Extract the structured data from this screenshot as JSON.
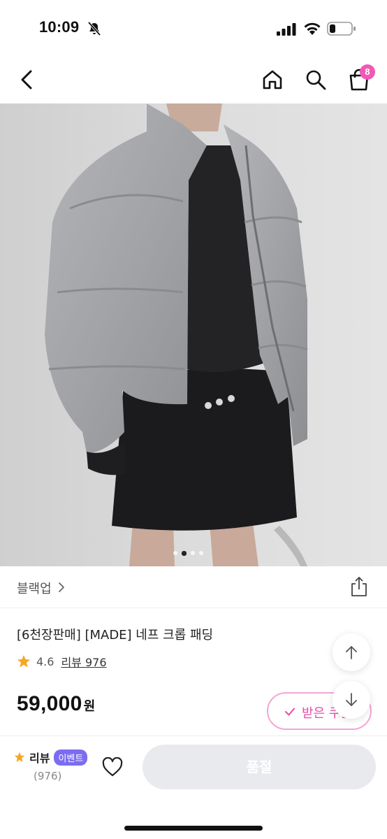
{
  "status_bar": {
    "time": "10:09"
  },
  "nav": {
    "cart_count": "8"
  },
  "gallery": {
    "total_images": 4,
    "active_index": 1
  },
  "brand": {
    "name": "블랙업"
  },
  "product": {
    "title": "[6천장판매] [MADE] 네프 크롭 패딩",
    "rating": "4.6",
    "review_link": "리뷰 976",
    "price": "59,000",
    "price_unit": "원",
    "coupon_label": "받은 쿠폰"
  },
  "bottom_bar": {
    "review_label": "리뷰",
    "event_badge": "이벤트",
    "review_count": "(976)",
    "soldout_label": "품절"
  },
  "colors": {
    "accent_pink": "#f05ab4",
    "coupon_pink": "#e84ba8",
    "event_purple": "#7b6cf0",
    "star_gold": "#f5a623",
    "disabled_gray": "#e9eaee"
  },
  "icons": [
    "bell-off-icon",
    "signal-icon",
    "wifi-icon",
    "battery-icon",
    "back-icon",
    "home-icon",
    "search-icon",
    "cart-icon",
    "chevron-right-icon",
    "share-icon",
    "star-icon",
    "arrow-up-icon",
    "arrow-down-icon",
    "check-icon",
    "heart-icon"
  ]
}
